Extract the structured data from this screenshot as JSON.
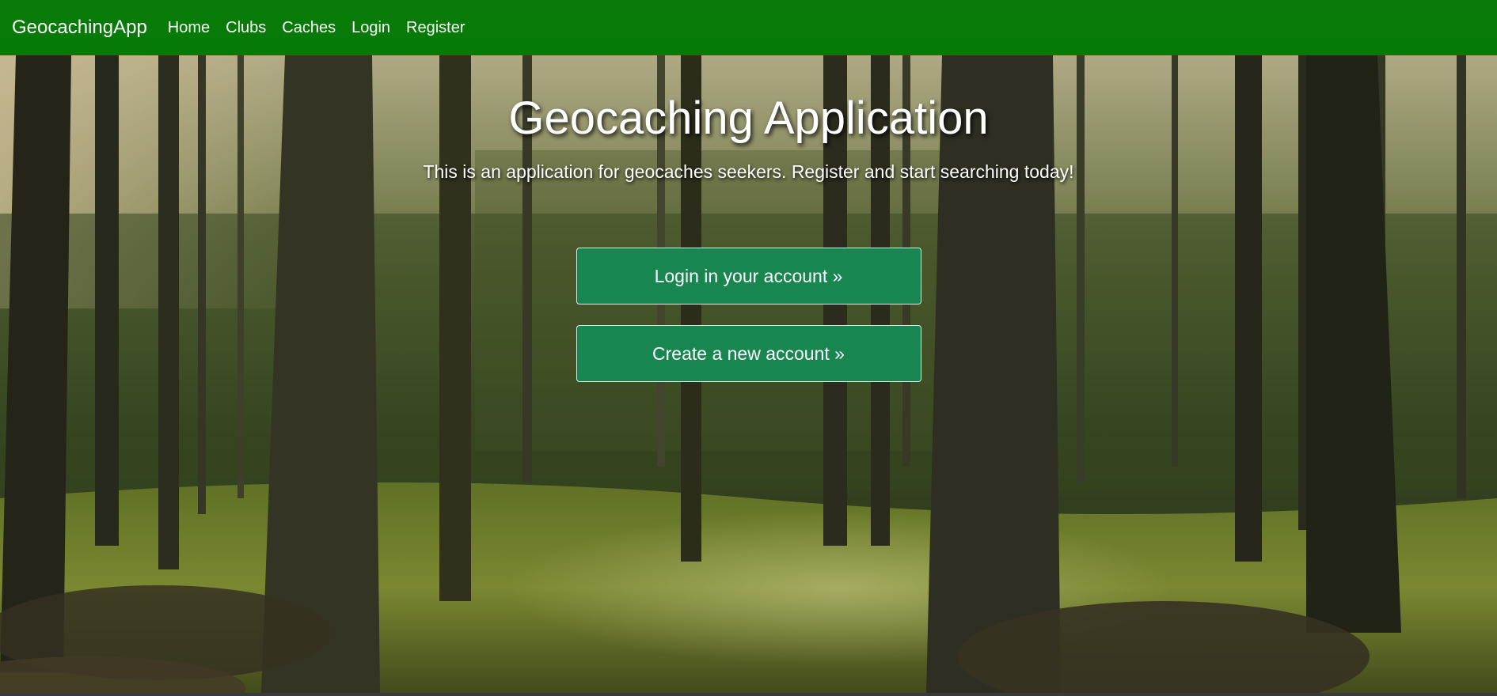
{
  "navbar": {
    "brand": "GeocachingApp",
    "links": [
      "Home",
      "Clubs",
      "Caches",
      "Login",
      "Register"
    ]
  },
  "hero": {
    "title": "Geocaching Application",
    "subtitle": "This is an application for geocaches seekers. Register and start searching today!",
    "login_button": "Login in your account »",
    "register_button": "Create a new account »",
    "background": "forest-photo"
  },
  "colors": {
    "navbar": "#057a05",
    "button": "#178650",
    "text": "#ffffff"
  }
}
